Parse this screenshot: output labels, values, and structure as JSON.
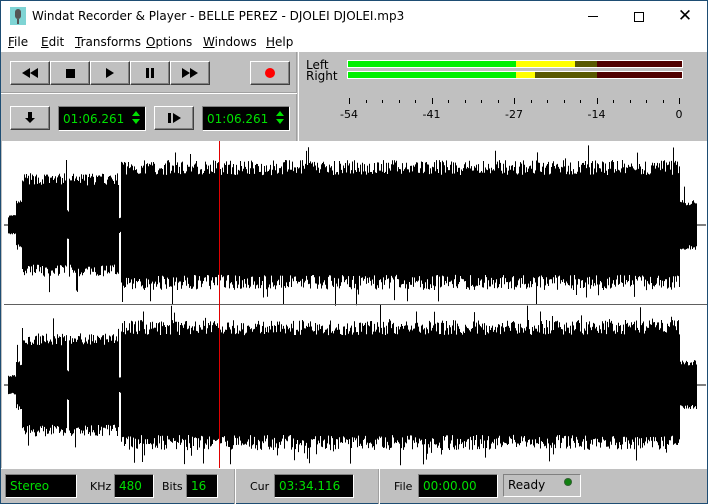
{
  "window": {
    "title": "Windat Recorder & Player - BELLE PEREZ - DJOLEI DJOLEI.mp3",
    "app_icon": "microphone-icon",
    "controls": [
      "minimize",
      "maximize",
      "close"
    ]
  },
  "menu": [
    {
      "label_u": "F",
      "label_rest": "ile"
    },
    {
      "label_u": "E",
      "label_rest": "dit"
    },
    {
      "label_u": "T",
      "label_rest": "ransforms"
    },
    {
      "label_u": "O",
      "label_rest": "ptions"
    },
    {
      "label_u": "W",
      "label_rest": "indows"
    },
    {
      "label_u": "H",
      "label_rest": "elp"
    }
  ],
  "transport": {
    "buttons": [
      "rewind",
      "stop",
      "play",
      "pause",
      "fast-forward"
    ],
    "record": "record"
  },
  "positions": {
    "start_time": "01:06.261",
    "end_time": "01:06.261"
  },
  "meter": {
    "left_label": "Left",
    "right_label": "Right",
    "scale": [
      "-54",
      "-41",
      "-27",
      "-14",
      "0"
    ],
    "colors": {
      "green": "#00f000",
      "yellow": "#ffff00",
      "olive": "#585800",
      "dark_red": "#500000"
    },
    "left": {
      "green_to_db": -27,
      "yellow_to_db": -17.5,
      "olive_to_db": -14
    },
    "right": {
      "green_to_db": -27,
      "yellow_to_db": -24,
      "olive_to_db": -14
    }
  },
  "waveform": {
    "cursor_color": "#e00000",
    "channels": [
      "left",
      "right"
    ]
  },
  "status": {
    "channels_value": "Stereo",
    "khz_label": "KHz",
    "khz_value": "480",
    "bits_label": "Bits",
    "bits_value": "16",
    "cur_label": "Cur",
    "cur_value": "03:34.116",
    "file_label": "File",
    "file_value": "00:00.00",
    "state": "Ready"
  }
}
